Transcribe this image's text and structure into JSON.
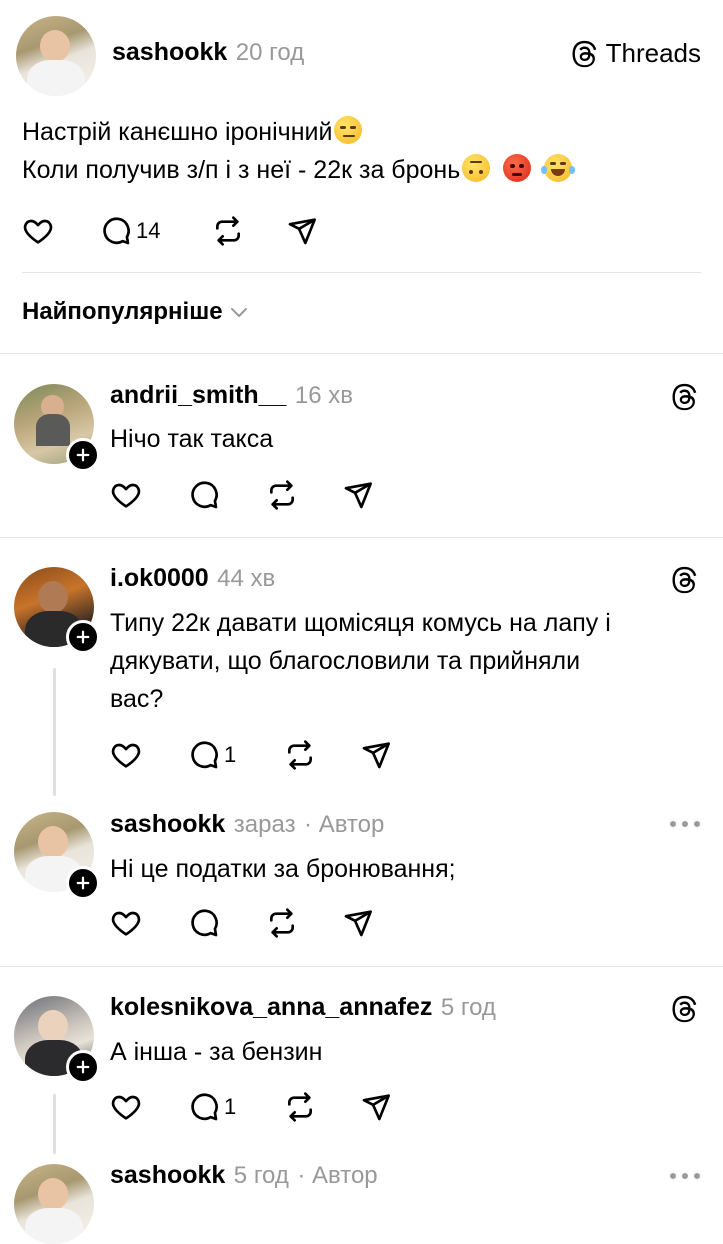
{
  "post": {
    "username": "sashookk",
    "time": "20 год",
    "brand": "Threads",
    "line1": "Настрій канєшно іронічний",
    "line2": "Коли получив з/п і з неї - 22к за бронь",
    "line1_emojis": [
      "smirking-face"
    ],
    "line2_emojis": [
      "upside-down-face",
      "angry-face",
      "tears-of-joy-face"
    ],
    "reply_count": "14"
  },
  "sort": {
    "label": "Найпопулярніше"
  },
  "comments": [
    {
      "username": "andrii_smith__",
      "time": "16 хв",
      "text": "Нічо так такса"
    },
    {
      "username": "i.ok0000",
      "time": "44 хв",
      "text_lines": [
        "Типу 22к давати щомісяця комусь на лапу і",
        "дякувати, що благословили та прийняли",
        "вас?"
      ],
      "reply_count": "1"
    },
    {
      "username": "sashookk",
      "time": "зараз",
      "author_tag": "· Автор",
      "text": "Ні це податки за бронювання;"
    },
    {
      "username": "kolesnikova_anna_annafez",
      "time": "5 год",
      "text": "А інша - за бензин",
      "reply_count": "1"
    },
    {
      "username": "sashookk",
      "time": "5 год",
      "author_tag": "· Автор"
    }
  ]
}
